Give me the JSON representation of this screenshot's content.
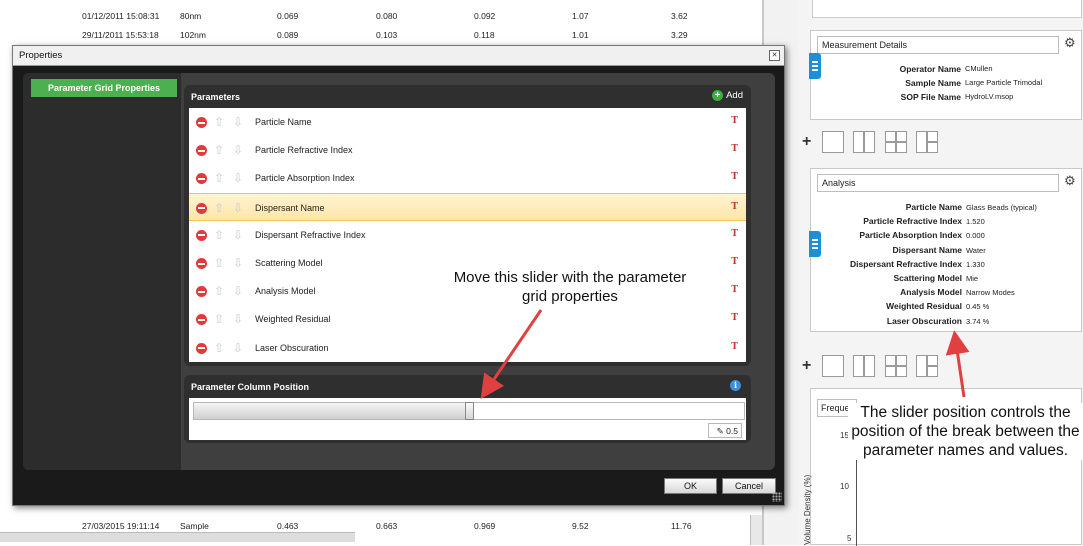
{
  "background_table": {
    "rows_top": [
      {
        "date": "01/12/2011 15:08:31",
        "name": "80nm",
        "c1": "0.069",
        "c2": "0.080",
        "c3": "0.092",
        "c4": "1.07",
        "c5": "3.62"
      },
      {
        "date": "29/11/2011 15:53:18",
        "name": "102nm",
        "c1": "0.089",
        "c2": "0.103",
        "c3": "0.118",
        "c4": "1.01",
        "c5": "3.29"
      }
    ],
    "rows_bottom": [
      {
        "date": "27/03/2015 19:11:14",
        "name": "Sample",
        "c1": "0.463",
        "c2": "0.663",
        "c3": "0.969",
        "c4": "9.52",
        "c5": "11.76"
      }
    ]
  },
  "dialog": {
    "title": "Properties",
    "sidebar": {
      "items": [
        {
          "label": "Parameter Grid Properties"
        }
      ]
    },
    "parameters_panel": {
      "header": "Parameters",
      "add_label": "Add",
      "items": [
        {
          "label": "Particle Name"
        },
        {
          "label": "Particle Refractive Index"
        },
        {
          "label": "Particle Absorption Index"
        },
        {
          "label": "Dispersant Name",
          "selected": true
        },
        {
          "label": "Dispersant Refractive Index"
        },
        {
          "label": "Scattering Model"
        },
        {
          "label": "Analysis Model"
        },
        {
          "label": "Weighted Residual"
        },
        {
          "label": "Laser Obscuration"
        }
      ],
      "text_icon_glyph": "T"
    },
    "column_position_panel": {
      "header": "Parameter Column Position",
      "slider_value": 0.5,
      "value_text": "0.5",
      "value_prefix_icon": "pencil-icon"
    },
    "buttons": {
      "ok": "OK",
      "cancel": "Cancel"
    }
  },
  "report": {
    "measurement_details": {
      "title": "Measurement Details",
      "rows": [
        {
          "key": "Operator Name",
          "value": "CMullen"
        },
        {
          "key": "Sample Name",
          "value": "Large Particle Trimodal"
        },
        {
          "key": "SOP File Name",
          "value": "HydroLV.msop"
        }
      ]
    },
    "analysis": {
      "title": "Analysis",
      "rows": [
        {
          "key": "Particle Name",
          "value": "Glass Beads (typical)"
        },
        {
          "key": "Particle Refractive Index",
          "value": "1.520"
        },
        {
          "key": "Particle Absorption Index",
          "value": "0.000"
        },
        {
          "key": "Dispersant Name",
          "value": "Water"
        },
        {
          "key": "Dispersant Refractive Index",
          "value": "1.330"
        },
        {
          "key": "Scattering Model",
          "value": "Mie"
        },
        {
          "key": "Analysis Model",
          "value": "Narrow Modes"
        },
        {
          "key": "Weighted Residual",
          "value": "0.45 %"
        },
        {
          "key": "Laser Obscuration",
          "value": "3.74 %"
        }
      ]
    },
    "chart": {
      "title": "Freque",
      "tick_15": "15",
      "tick_10": "10",
      "tick_5": "5",
      "ylabel": "Volume Density (%)"
    },
    "add_glyph": "+"
  },
  "annotations": {
    "slider_hint": "Move this slider with the parameter grid properties",
    "position_hint": "The slider position controls the position of the break between the parameter names and values."
  },
  "colors": {
    "accent_green": "#4caf50",
    "arrow_red": "#e04040",
    "selection": "#fde6a8",
    "report_tab_blue": "#1d8fd9"
  }
}
